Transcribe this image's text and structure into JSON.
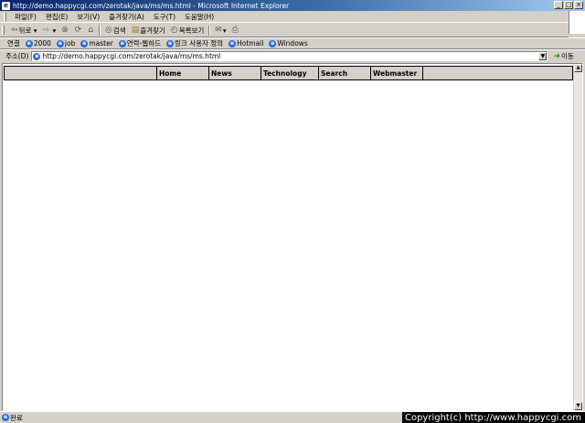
{
  "window": {
    "title": "http://demo.happycgi.com/zerotak/java/ms/ms.html - Microsoft Internet Explorer",
    "controls": [
      "_",
      "□",
      "×"
    ]
  },
  "menu": {
    "items": [
      "파일(F)",
      "편집(E)",
      "보기(V)",
      "즐겨찾기(A)",
      "도구(T)",
      "도움말(H)"
    ]
  },
  "toolbar": {
    "back_label": "뒤로",
    "search_label": "검색",
    "favorites_label": "즐겨찾기",
    "history_label": "목록보기"
  },
  "links": {
    "label": "연결",
    "items": [
      "2000",
      "job",
      "master",
      "연락-웹하드",
      "링크 사용자 정의",
      "Hotmail",
      "Windows"
    ]
  },
  "address": {
    "label": "주소(D)",
    "url": "http://demo.happycgi.com/zerotak/java/ms/ms.html",
    "go_label": "이동"
  },
  "page": {
    "nav": [
      "Home",
      "News",
      "Technology",
      "Search",
      "Webmaster"
    ]
  },
  "status": {
    "text": "완료",
    "copyright": "Copyright(c) http://www.happycgi.com"
  }
}
